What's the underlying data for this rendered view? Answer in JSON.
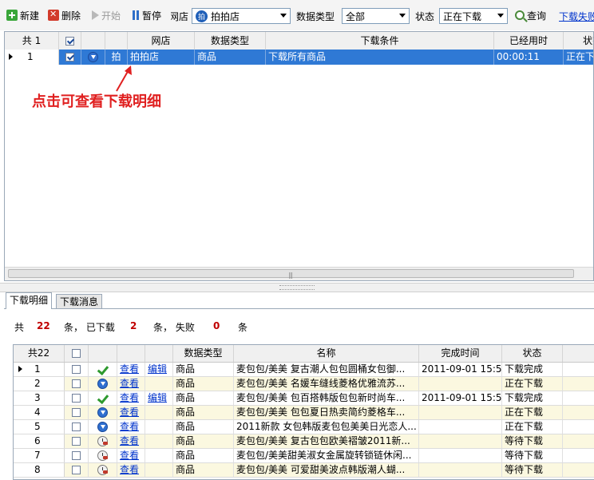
{
  "toolbar": {
    "new_label": "新建",
    "delete_label": "删除",
    "start_label": "开始",
    "pause_label": "暂停",
    "shop_label": "网店",
    "shop_value": "拍拍店",
    "shop_logo": "拍",
    "datatype_label": "数据类型",
    "datatype_value": "全部",
    "status_label": "状态",
    "status_value": "正在下载",
    "query_label": "查询",
    "link_label": "下载失败"
  },
  "top_grid": {
    "headers": {
      "count": "共 1",
      "shop": "网店",
      "datatype": "数据类型",
      "condition": "下载条件",
      "elapsed": "已经用时",
      "status": "状态"
    },
    "row": {
      "num": "1",
      "checked": true,
      "logo": "拍",
      "shop": "拍拍店",
      "datatype": "商品",
      "condition": "下载所有商品",
      "elapsed": "00:00:11",
      "status": "正在下载"
    }
  },
  "annotation": "点击可查看下载明细",
  "tabs": [
    "下载明细",
    "下载消息"
  ],
  "summary": {
    "prefix": "共",
    "total": "22",
    "mid1": "条， 已下载",
    "downloaded": "2",
    "mid2": "条， 失败",
    "failed": "0",
    "suffix": "条"
  },
  "bottom_grid": {
    "headers": {
      "count": "共22",
      "datatype": "数据类型",
      "name": "名称",
      "finish": "完成时间",
      "status": "状态"
    },
    "rows": [
      {
        "num": "1",
        "state": "done",
        "view": "查看",
        "edit": "编辑",
        "datatype": "商品",
        "name": "麦包包/美美 复古潮人包包圆桶女包御...",
        "finish": "2011-09-01 15:5...",
        "status": "下载完成"
      },
      {
        "num": "2",
        "state": "downloading",
        "view": "查看",
        "edit": "",
        "datatype": "商品",
        "name": "麦包包/美美 名媛车缝线菱格优雅流苏...",
        "finish": "",
        "status": "正在下载"
      },
      {
        "num": "3",
        "state": "done",
        "view": "查看",
        "edit": "编辑",
        "datatype": "商品",
        "name": "麦包包/美美 包百搭韩版包包新时尚车...",
        "finish": "2011-09-01 15:5...",
        "status": "下载完成"
      },
      {
        "num": "4",
        "state": "downloading",
        "view": "查看",
        "edit": "",
        "datatype": "商品",
        "name": "麦包包/美美 包包夏日热卖简约菱格车...",
        "finish": "",
        "status": "正在下载"
      },
      {
        "num": "5",
        "state": "downloading",
        "view": "查看",
        "edit": "",
        "datatype": "商品",
        "name": "2011新款 女包韩版麦包包美美日光恋人...",
        "finish": "",
        "status": "正在下载"
      },
      {
        "num": "6",
        "state": "waiting",
        "view": "查看",
        "edit": "",
        "datatype": "商品",
        "name": "麦包包/美美 复古包包欧美褶皱2011新...",
        "finish": "",
        "status": "等待下载"
      },
      {
        "num": "7",
        "state": "waiting",
        "view": "查看",
        "edit": "",
        "datatype": "商品",
        "name": "麦包包/美美甜美淑女金属旋转锁链休闲...",
        "finish": "",
        "status": "等待下载"
      },
      {
        "num": "8",
        "state": "waiting",
        "view": "查看",
        "edit": "",
        "datatype": "商品",
        "name": "麦包包/美美 可爱甜美波点韩版潮人蝴...",
        "finish": "",
        "status": "等待下载"
      }
    ]
  },
  "colors": {
    "selection": "#2f79d5",
    "alt_row": "#fbf8e0",
    "annotation": "#e02020",
    "summary_numbers": "#c00000"
  }
}
